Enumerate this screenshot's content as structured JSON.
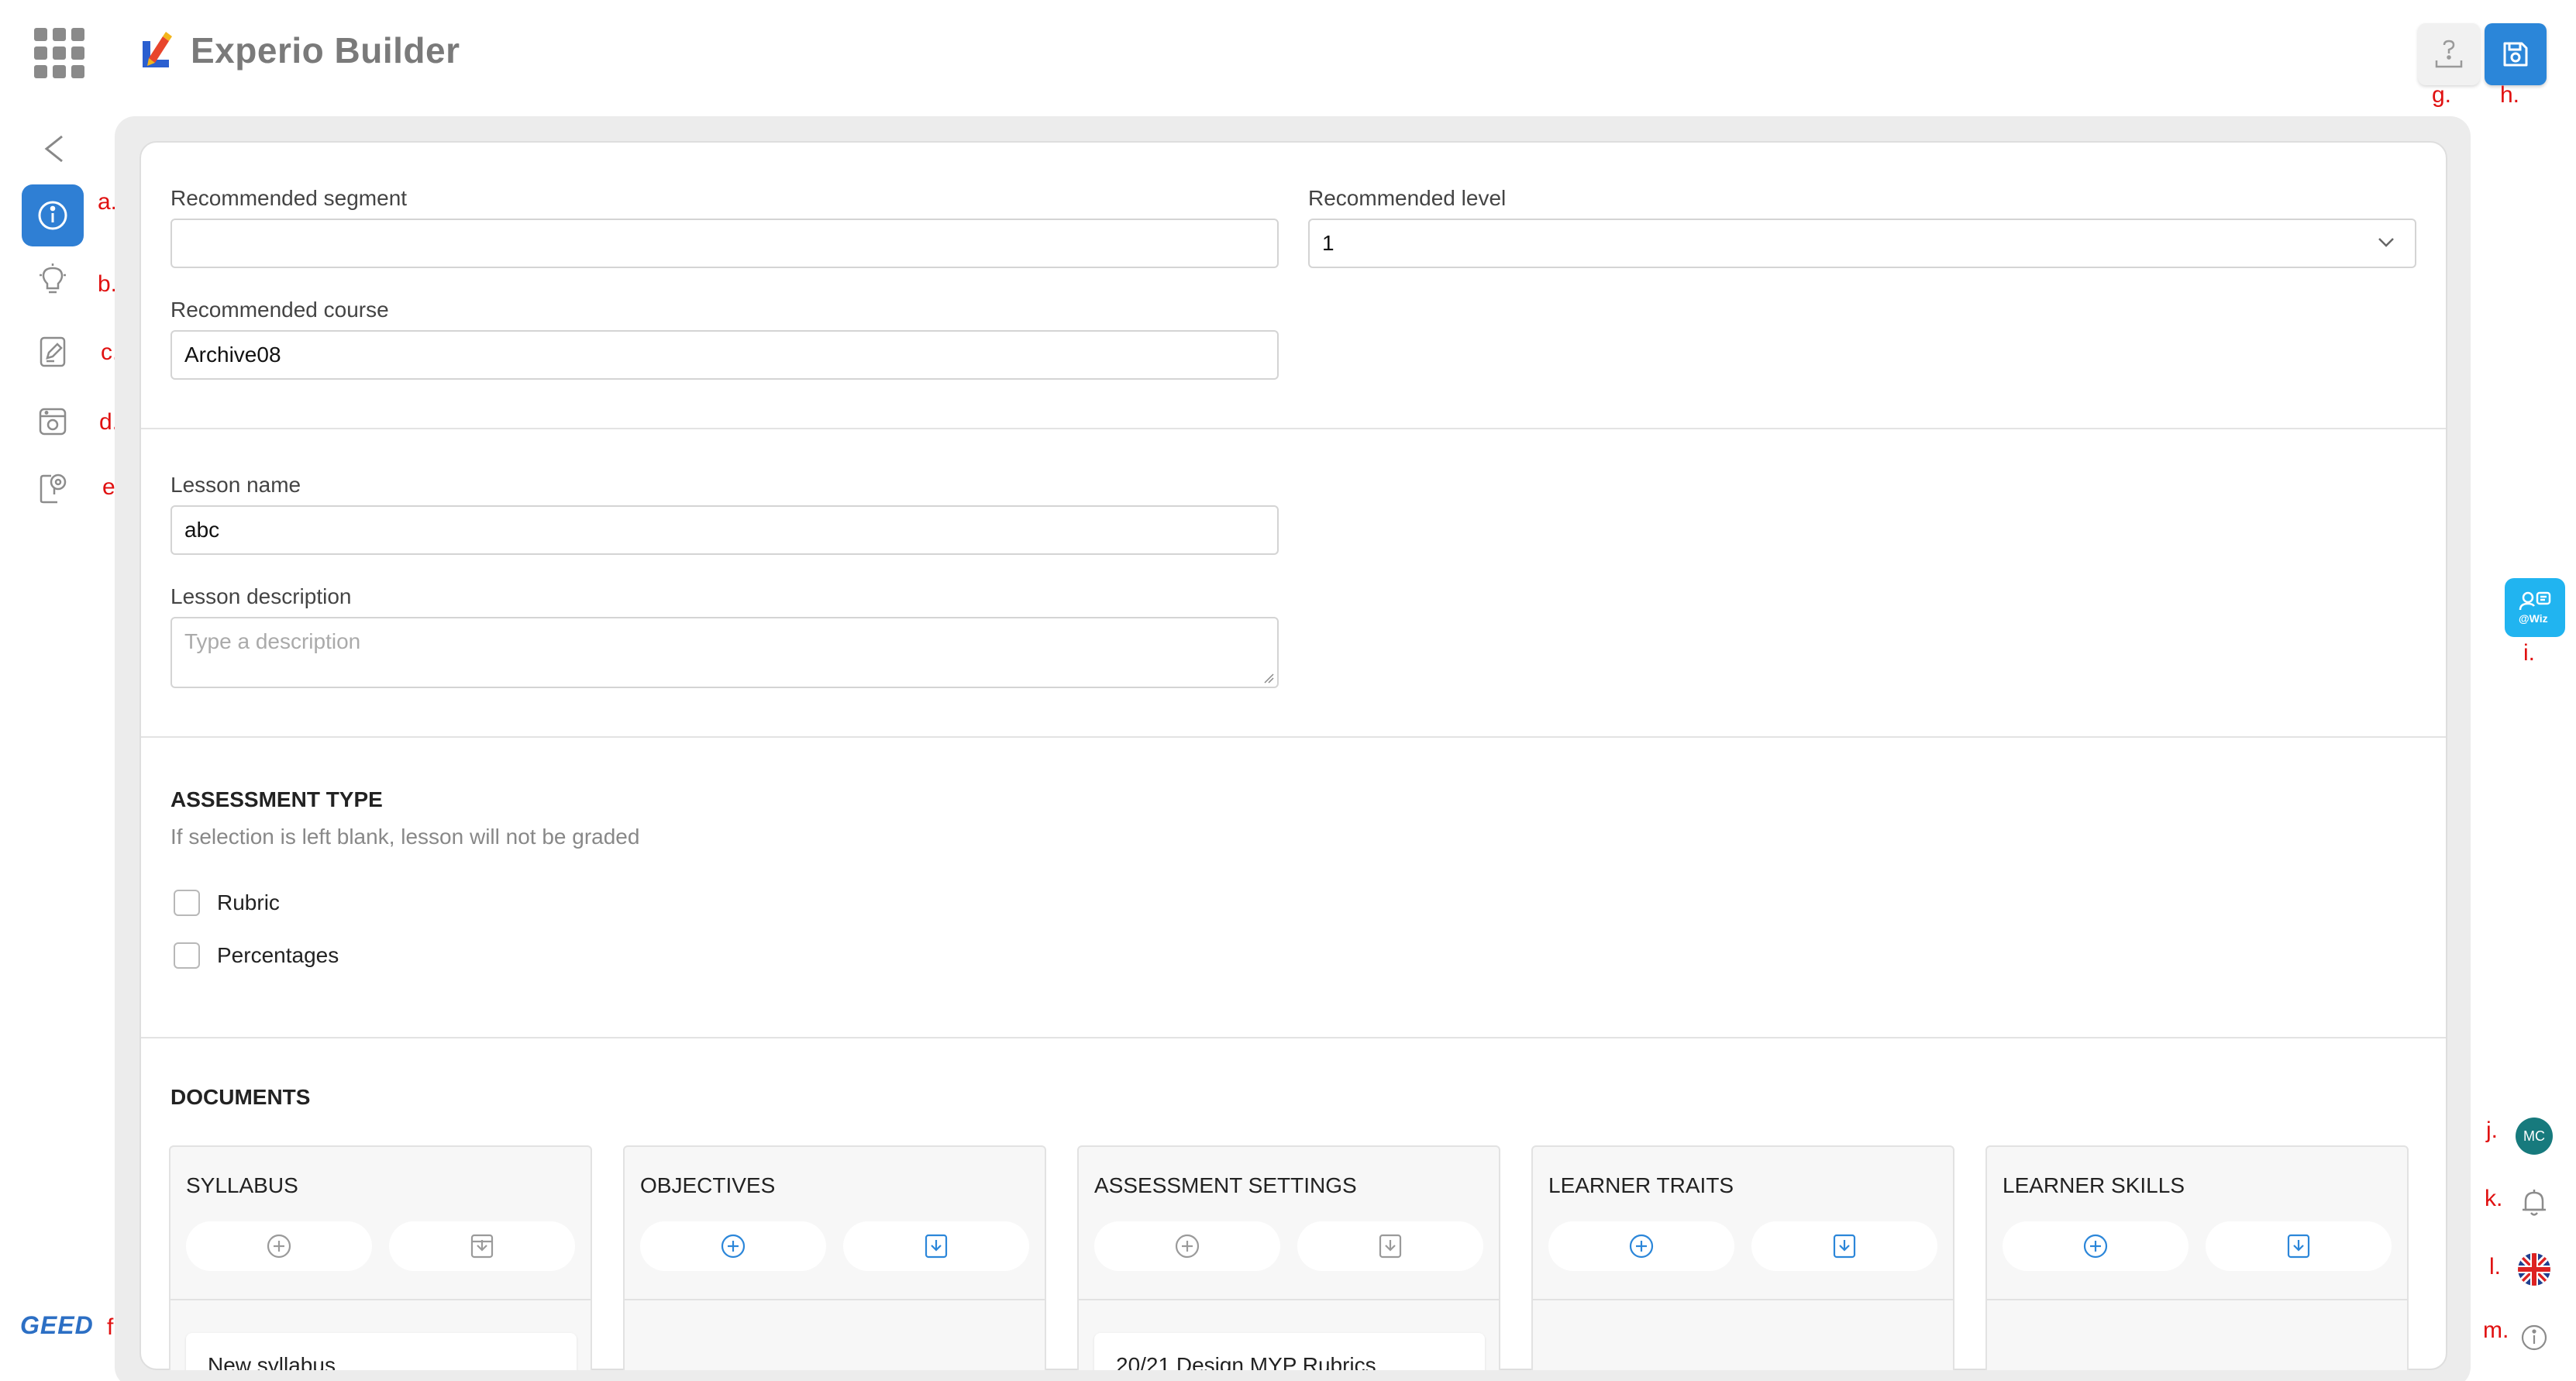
{
  "app": {
    "title": "Experio Builder"
  },
  "markers": {
    "a": "a.",
    "b": "b.",
    "c": "c.",
    "d": "d.",
    "e": "e.",
    "f": "f.",
    "g": "g.",
    "h": "h.",
    "i": "i.",
    "j": "j.",
    "k": "k.",
    "l": "l.",
    "m": "m."
  },
  "sidebar": {
    "items": [
      {
        "icon": "info-icon",
        "active": true
      },
      {
        "icon": "lightbulb-icon",
        "active": false
      },
      {
        "icon": "edit-document-icon",
        "active": false
      },
      {
        "icon": "camera-panel-icon",
        "active": false
      },
      {
        "icon": "tag-document-icon",
        "active": false
      }
    ],
    "footer_logo": "GEED"
  },
  "recommendation": {
    "segment": {
      "label": "Recommended segment",
      "value": ""
    },
    "level": {
      "label": "Recommended level",
      "value": "1"
    },
    "course": {
      "label": "Recommended course",
      "value": "Archive08"
    }
  },
  "lesson": {
    "name": {
      "label": "Lesson name",
      "value": "abc"
    },
    "description": {
      "label": "Lesson description",
      "placeholder": "Type a description"
    }
  },
  "assessment": {
    "title": "ASSESSMENT TYPE",
    "hint": "If selection is left blank, lesson will not be graded",
    "options": [
      {
        "label": "Rubric",
        "checked": false
      },
      {
        "label": "Percentages",
        "checked": false
      }
    ]
  },
  "documents": {
    "title": "DOCUMENTS",
    "columns": [
      {
        "title": "SYLLABUS",
        "enabled": false,
        "items": [
          "New syllabus"
        ]
      },
      {
        "title": "OBJECTIVES",
        "enabled": true,
        "items": []
      },
      {
        "title": "ASSESSMENT SETTINGS",
        "enabled": false,
        "items": [
          "20/21 Design MYP Rubrics"
        ]
      },
      {
        "title": "LEARNER TRAITS",
        "enabled": true,
        "items": []
      },
      {
        "title": "LEARNER SKILLS",
        "enabled": true,
        "items": []
      }
    ]
  },
  "right_rail": {
    "wiz_label": "Wiz",
    "avatar_initials": "MC"
  },
  "colors": {
    "accent": "#2b86d9",
    "wiz": "#21b4f0",
    "avatar": "#177a7d",
    "marker": "#e01010"
  }
}
